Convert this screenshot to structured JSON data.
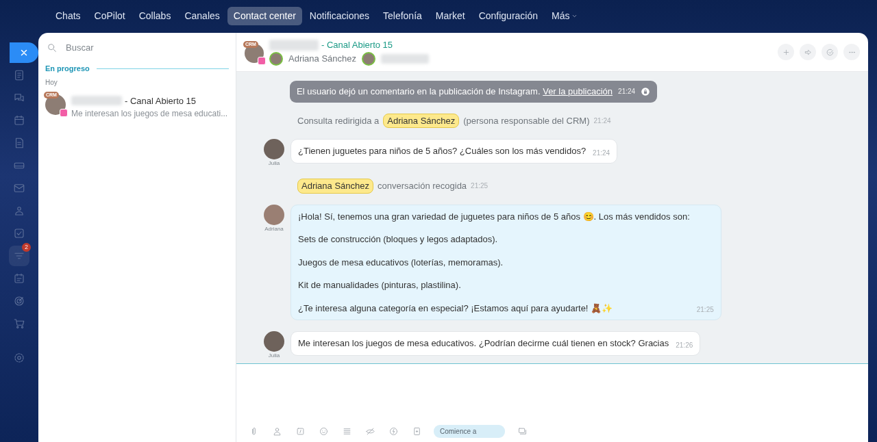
{
  "top_nav": {
    "tabs": [
      {
        "label": "Chats",
        "selected": false
      },
      {
        "label": "CoPilot",
        "selected": false
      },
      {
        "label": "Collabs",
        "selected": false
      },
      {
        "label": "Canales",
        "selected": false
      },
      {
        "label": "Contact center",
        "selected": true
      },
      {
        "label": "Notificaciones",
        "selected": false
      },
      {
        "label": "Telefonía",
        "selected": false
      },
      {
        "label": "Market",
        "selected": false
      },
      {
        "label": "Configuración",
        "selected": false
      },
      {
        "label": "Más",
        "selected": false,
        "dropdown": true
      }
    ]
  },
  "rail": {
    "items": [
      {
        "selected": false
      },
      {
        "selected": false
      },
      {
        "selected": false
      },
      {
        "selected": false
      },
      {
        "selected": false
      },
      {
        "selected": false
      },
      {
        "selected": false
      },
      {
        "selected": false
      },
      {
        "selected": true,
        "badge": "2"
      },
      {
        "selected": false
      },
      {
        "selected": false
      },
      {
        "selected": false
      },
      {
        "selected": false
      }
    ]
  },
  "sidebar": {
    "search": {
      "placeholder": "Buscar"
    },
    "section": "En progreso",
    "day": "Hoy",
    "chats": [
      {
        "badge": "CRM",
        "title": "- Canal Abierto 15",
        "preview": "Me interesan los juegos de mesa educati...",
        "selected": false
      }
    ]
  },
  "chat": {
    "badge": "CRM",
    "title": "- Canal Abierto 15",
    "participant": "Adriana Sánchez",
    "messages": [
      {
        "kind": "system",
        "text": "El usuario dejó un comentario en la publicación de Instagram.",
        "link": "Ver la publicación",
        "time": "21:24"
      },
      {
        "kind": "notice",
        "before": "Consulta redirigida a",
        "chip": "Adriana Sánchez",
        "after": "(persona responsable del CRM)",
        "time": "21:24"
      },
      {
        "kind": "client",
        "author": "Julia",
        "paragraphs": [
          "¿Tienen juguetes para niños de 5 años? ¿Cuáles son los más vendidos?"
        ],
        "time": "21:24"
      },
      {
        "kind": "notice",
        "chip": "Adriana Sánchez",
        "after": "conversación recogida",
        "time": "21:25"
      },
      {
        "kind": "operator",
        "author": "Adriana",
        "paragraphs": [
          "¡Hola! Sí, tenemos una gran variedad de juguetes para niños de 5 años 😊. Los más vendidos son:",
          "Sets de construcción (bloques y legos adaptados).",
          "Juegos de mesa educativos (loterías, memoramas).",
          "Kit de manualidades (pinturas, plastilina).",
          "¿Te interesa alguna categoría en especial? ¡Estamos aquí para ayudarte! 🧸✨"
        ],
        "time": "21:25"
      },
      {
        "kind": "client",
        "author": "Julia",
        "paragraphs": [
          "Me interesan los juegos de mesa educativos. ¿Podrían decirme cuál tienen en stock? Gracias"
        ],
        "time": "21:26"
      }
    ],
    "composer": {
      "start_button": "Comience a"
    }
  }
}
